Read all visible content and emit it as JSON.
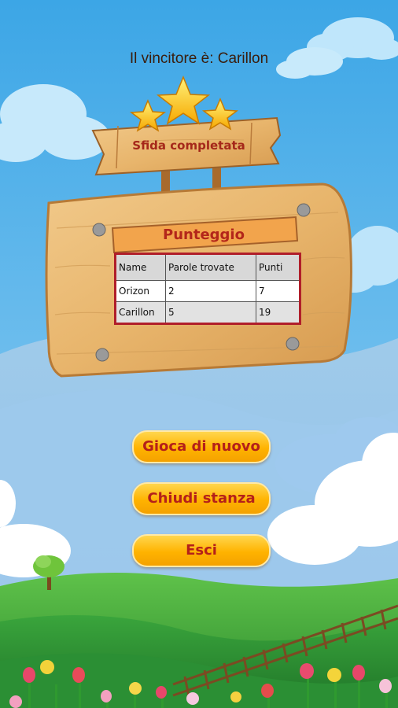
{
  "winner_text": "Il vincitore è: Carillon",
  "sign_title": "Sfida completata",
  "score_title": "Punteggio",
  "table": {
    "headers": [
      "Name",
      "Parole trovate",
      "Punti"
    ],
    "rows": [
      [
        "Orizon",
        "2",
        "7"
      ],
      [
        "Carillon",
        "5",
        "19"
      ]
    ]
  },
  "buttons": {
    "play_again": "Gioca di nuovo",
    "close_room": "Chiudi stanza",
    "exit": "Esci"
  },
  "colors": {
    "sky": "#4aaee8",
    "wood": "#e7b56e",
    "button": "#ffbe1a",
    "button_text": "#b4201a",
    "table_border": "#b01e2a"
  }
}
